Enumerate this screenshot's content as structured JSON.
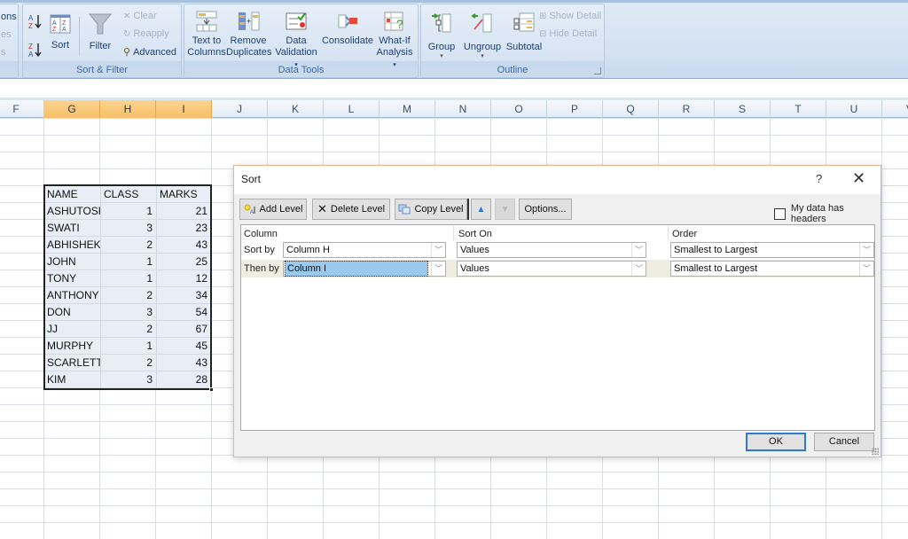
{
  "ribbon": {
    "partial_left_labels": [
      "ons",
      "es",
      "s"
    ],
    "groups": [
      {
        "label": "Sort & Filter",
        "buttons": [
          {
            "label": "Sort A to Z",
            "icon": "sort-a-z-icon"
          },
          {
            "label": "Sort Z to A",
            "icon": "sort-z-a-icon"
          },
          {
            "label": "Sort",
            "icon": "sort-icon"
          },
          {
            "label": "Filter",
            "icon": "filter-icon"
          }
        ],
        "small_buttons": [
          {
            "label": "Clear",
            "enabled": false,
            "icon": "clear-filter-icon"
          },
          {
            "label": "Reapply",
            "enabled": false,
            "icon": "reapply-icon"
          },
          {
            "label": "Advanced",
            "enabled": true,
            "icon": "advanced-filter-icon"
          }
        ]
      },
      {
        "label": "Data Tools",
        "buttons": [
          {
            "line1": "Text to",
            "line2": "Columns",
            "icon": "text-to-columns-icon"
          },
          {
            "line1": "Remove",
            "line2": "Duplicates",
            "icon": "remove-duplicates-icon"
          },
          {
            "line1": "Data",
            "line2": "Validation",
            "dropdown": true,
            "icon": "data-validation-icon"
          },
          {
            "line1": "Consolidate",
            "line2": "",
            "icon": "consolidate-icon"
          },
          {
            "line1": "What-If",
            "line2": "Analysis",
            "dropdown": true,
            "icon": "what-if-icon"
          }
        ]
      },
      {
        "label": "Outline",
        "buttons": [
          {
            "label": "Group",
            "dropdown": true,
            "icon": "group-icon"
          },
          {
            "label": "Ungroup",
            "dropdown": true,
            "icon": "ungroup-icon"
          },
          {
            "label": "Subtotal",
            "icon": "subtotal-icon"
          }
        ],
        "small_buttons": [
          {
            "label": "Show Detail",
            "enabled": false,
            "icon": "show-detail-icon"
          },
          {
            "label": "Hide Detail",
            "enabled": false,
            "icon": "hide-detail-icon"
          }
        ]
      }
    ]
  },
  "columns": [
    {
      "label": "F",
      "selected": false
    },
    {
      "label": "G",
      "selected": true
    },
    {
      "label": "H",
      "selected": true
    },
    {
      "label": "I",
      "selected": true
    },
    {
      "label": "J",
      "selected": false
    },
    {
      "label": "K",
      "selected": false
    },
    {
      "label": "L",
      "selected": false
    },
    {
      "label": "M",
      "selected": false
    },
    {
      "label": "N",
      "selected": false
    },
    {
      "label": "O",
      "selected": false
    },
    {
      "label": "P",
      "selected": false
    },
    {
      "label": "Q",
      "selected": false
    },
    {
      "label": "R",
      "selected": false
    },
    {
      "label": "S",
      "selected": false
    },
    {
      "label": "T",
      "selected": false
    },
    {
      "label": "U",
      "selected": false
    },
    {
      "label": "V",
      "selected": false
    }
  ],
  "table": {
    "headers": [
      "NAME",
      "CLASS",
      "MARKS"
    ],
    "rows": [
      [
        "ASHUTOSH",
        "1",
        "21"
      ],
      [
        "SWATI",
        "3",
        "23"
      ],
      [
        "ABHISHEK",
        "2",
        "43"
      ],
      [
        "JOHN",
        "1",
        "25"
      ],
      [
        "TONY",
        "1",
        "12"
      ],
      [
        "ANTHONY",
        "2",
        "34"
      ],
      [
        "DON",
        "3",
        "54"
      ],
      [
        "JJ",
        "2",
        "67"
      ],
      [
        "MURPHY",
        "1",
        "45"
      ],
      [
        "SCARLETT",
        "2",
        "43"
      ],
      [
        "KIM",
        "3",
        "28"
      ]
    ]
  },
  "dialog": {
    "title": "Sort",
    "help": "?",
    "close": "✕",
    "toolbar": {
      "add_level": "Add Level",
      "delete_level": "Delete Level",
      "copy_level": "Copy Level",
      "options": "Options..."
    },
    "my_data_has_headers": {
      "label": "My data has headers",
      "checked": false
    },
    "column_headers": {
      "column": "Column",
      "sort_on": "Sort On",
      "order": "Order"
    },
    "levels": [
      {
        "label": "Sort by",
        "column": "Column H",
        "sort_on": "Values",
        "order": "Smallest to Largest",
        "selected": false
      },
      {
        "label": "Then by",
        "column": "Column I",
        "sort_on": "Values",
        "order": "Smallest to Largest",
        "selected": true
      }
    ],
    "ok": "OK",
    "cancel": "Cancel"
  }
}
